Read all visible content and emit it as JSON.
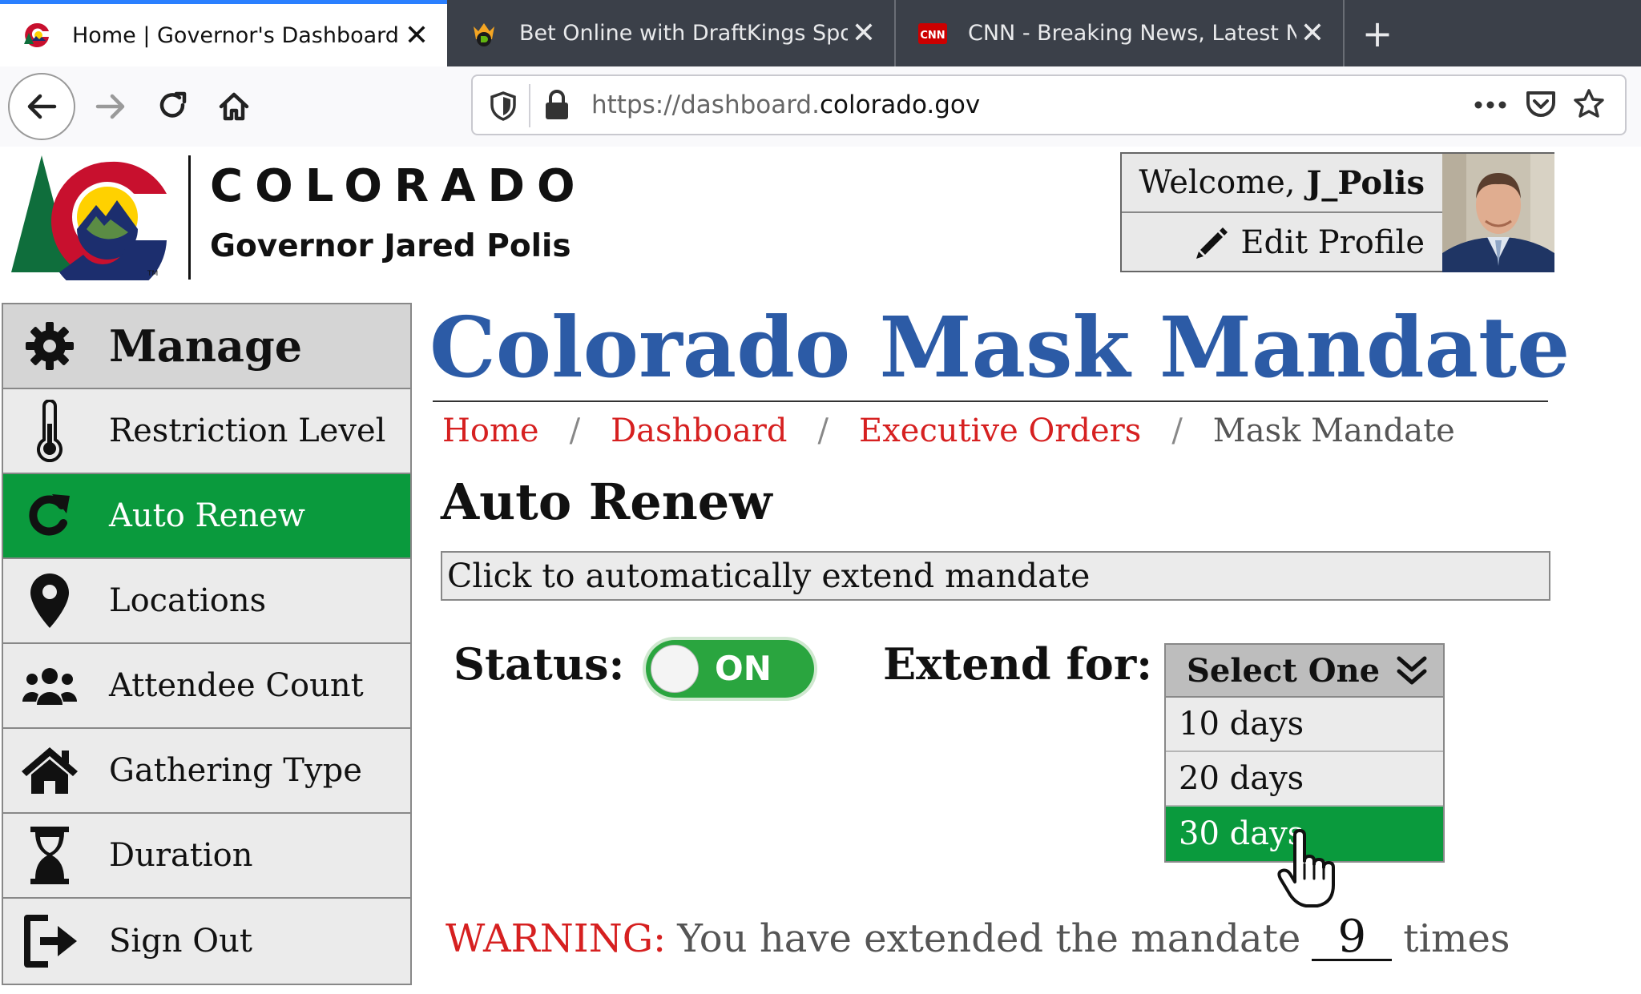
{
  "browser": {
    "tabs": [
      {
        "title": "Home | Governor's Dashboard",
        "active": true,
        "icon": "colorado-favicon"
      },
      {
        "title": "Bet Online with DraftKings Spor",
        "active": false,
        "icon": "draftkings-favicon"
      },
      {
        "title": "CNN - Breaking News, Latest N",
        "active": false,
        "icon": "cnn-favicon"
      }
    ],
    "close_glyph": "✕",
    "new_tab_glyph": "+",
    "url": {
      "prefix": "https://dashboard.",
      "domain": "colorado.gov"
    },
    "accent": "#2a7fff"
  },
  "header": {
    "state": "COLORADO",
    "governor": "Governor Jared Polis",
    "welcome": "Welcome,",
    "username": "J_Polis",
    "edit_profile": "Edit Profile"
  },
  "sidebar": {
    "header": {
      "label": "Manage",
      "icon": "gear-icon"
    },
    "items": [
      {
        "label": "Restriction Level",
        "icon": "thermometer-icon",
        "active": false
      },
      {
        "label": "Auto Renew",
        "icon": "refresh-icon",
        "active": true
      },
      {
        "label": "Locations",
        "icon": "map-pin-icon",
        "active": false
      },
      {
        "label": "Attendee Count",
        "icon": "users-icon",
        "active": false
      },
      {
        "label": "Gathering Type",
        "icon": "house-icon",
        "active": false
      },
      {
        "label": "Duration",
        "icon": "hourglass-icon",
        "active": false
      },
      {
        "label": "Sign Out",
        "icon": "sign-out-icon",
        "active": false
      }
    ],
    "active_color": "#0a9a3d"
  },
  "main": {
    "title": "Colorado Mask Mandate",
    "title_color": "#2c5ba6",
    "breadcrumb": [
      "Home",
      "Dashboard",
      "Executive Orders",
      "Mask Mandate"
    ],
    "breadcrumb_separator": "/",
    "section_title": "Auto Renew",
    "description": "Click to automatically extend mandate",
    "status": {
      "label": "Status:",
      "value": "ON",
      "on": true
    },
    "extend": {
      "label": "Extend for:",
      "placeholder": "Select One",
      "options": [
        "10 days",
        "20 days",
        "30 days"
      ],
      "selected": "30 days"
    },
    "warning": {
      "prefix": "WARNING:",
      "text": "You have extended the mandate",
      "count": "9",
      "suffix": "times"
    },
    "warning_color": "#d62020"
  }
}
